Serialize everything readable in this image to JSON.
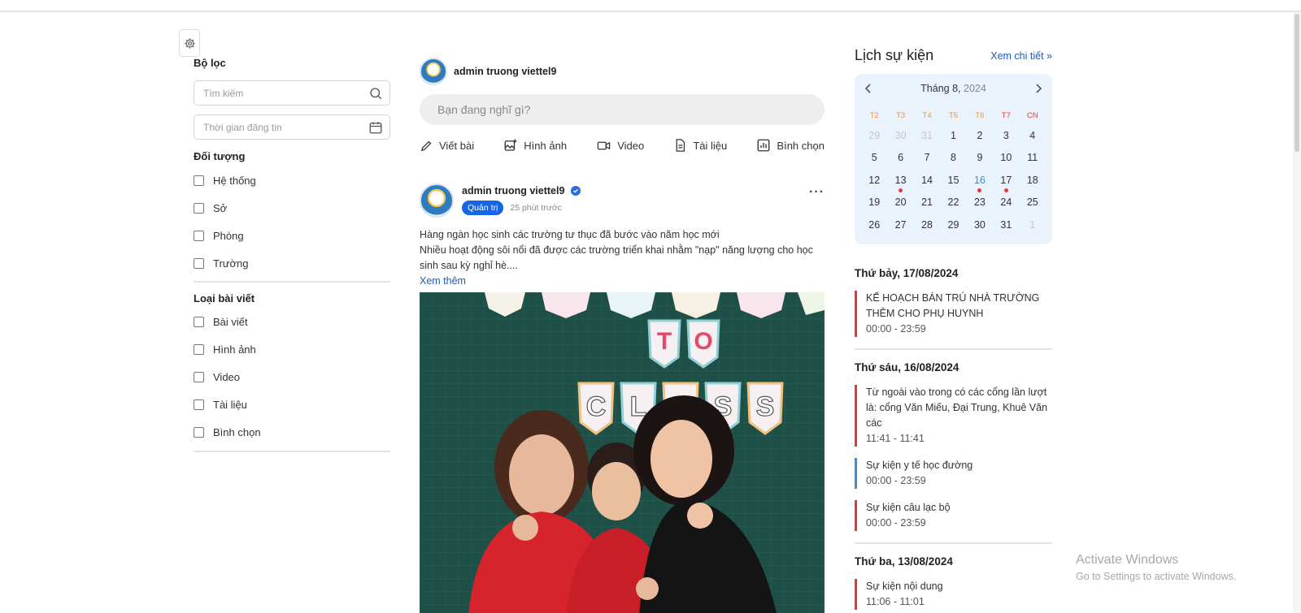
{
  "filter": {
    "title": "Bộ lọc",
    "search_placeholder": "Tìm kiếm",
    "date_placeholder": "Thời gian đăng tin",
    "audience_title": "Đối tượng",
    "audience": [
      "Hệ thống",
      "Sở",
      "Phòng",
      "Trường"
    ],
    "type_title": "Loại bài viết",
    "types": [
      "Bài viết",
      "Hình ảnh",
      "Video",
      "Tài liệu",
      "Bình chọn"
    ]
  },
  "composer": {
    "user": "admin truong viettel9",
    "placeholder": "Bạn đang nghĩ gì?",
    "actions": [
      "Viết bài",
      "Hình ảnh",
      "Video",
      "Tài liệu",
      "Bình chọn"
    ]
  },
  "post": {
    "author": "admin truong viettel9",
    "role": "Quản trị",
    "time": "25 phút trước",
    "line1": "Hàng ngàn học sinh các trường tư thục đã bước vào năm học mới",
    "line2": "Nhiều hoạt động sôi nổi đã được các trường triển khai nhằm \"nạp\" năng lượng cho học sinh sau kỳ nghỉ hè....",
    "see_more": "Xem thêm",
    "banner_top": [
      "T",
      "O"
    ],
    "banner_bottom": [
      "C",
      "L",
      "A",
      "S",
      "S"
    ]
  },
  "events": {
    "title": "Lịch sự kiện",
    "see_detail": "Xem chi tiết",
    "month": "Tháng 8,",
    "year": "2024",
    "weekdays": [
      "T2",
      "T3",
      "T4",
      "T5",
      "T6",
      "T7",
      "CN"
    ],
    "weeks": [
      [
        "29",
        "30",
        "31",
        "1",
        "2",
        "3",
        "4"
      ],
      [
        "5",
        "6",
        "7",
        "8",
        "9",
        "10",
        "11"
      ],
      [
        "12",
        "13",
        "14",
        "15",
        "16",
        "17",
        "18"
      ],
      [
        "19",
        "20",
        "21",
        "22",
        "23",
        "24",
        "25"
      ],
      [
        "26",
        "27",
        "28",
        "29",
        "30",
        "31",
        "1"
      ]
    ],
    "groups": [
      {
        "date": "Thứ bảy, 17/08/2024",
        "items": [
          {
            "title": "KẾ HOẠCH BÁN TRÚ NHÀ TRƯỜNG THÊM CHO PHỤ HUYNH",
            "time": "00:00 - 23:59",
            "color": "#e53935"
          }
        ]
      },
      {
        "date": "Thứ sáu, 16/08/2024",
        "items": [
          {
            "title": "Từ ngoài vào trong có các cổng lần lượt là: cổng Văn Miếu, Đại Trung, Khuê Văn các",
            "time": "11:41 - 11:41",
            "color": "#e53935"
          },
          {
            "title": "Sự kiện y tế học đường",
            "time": "00:00 - 23:59",
            "color": "#3a8fd6"
          },
          {
            "title": "Sự kiện câu lạc bộ",
            "time": "00:00 - 23:59",
            "color": "#e53935"
          }
        ]
      },
      {
        "date": "Thứ ba, 13/08/2024",
        "items": [
          {
            "title": "Sự kiện nội dung",
            "time": "11:06 - 11:01",
            "color": "#e53935"
          }
        ]
      }
    ]
  },
  "watermark": {
    "line1": "Activate Windows",
    "line2": "Go to Settings to activate Windows."
  },
  "colors": {
    "accent": "#1565e6",
    "link": "#1e5bbf",
    "event_red": "#e53935",
    "event_blue": "#3a8fd6",
    "calendar_bg": "#eaf2fb"
  }
}
